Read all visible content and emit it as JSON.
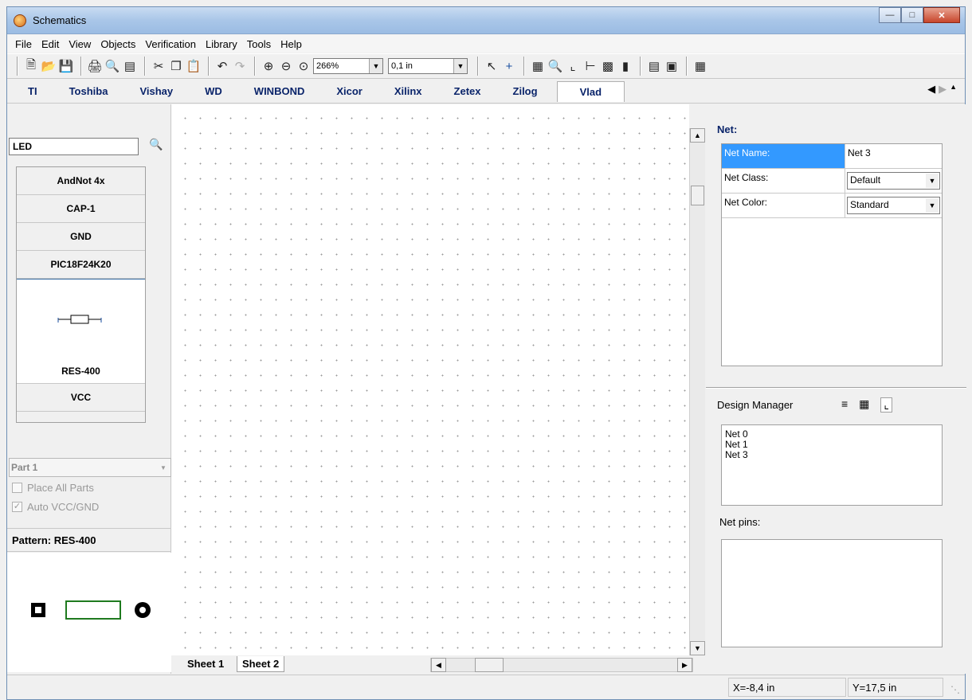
{
  "window": {
    "title": "Schematics"
  },
  "menu": [
    "File",
    "Edit",
    "View",
    "Objects",
    "Verification",
    "Library",
    "Tools",
    "Help"
  ],
  "toolbar": {
    "zoom": "266%",
    "grid": "0,1 in"
  },
  "libraries": [
    "TI",
    "Toshiba",
    "Vishay",
    "WD",
    "WINBOND",
    "Xicor",
    "Xilinx",
    "Zetex",
    "Zilog",
    "Vlad"
  ],
  "left": {
    "search_value": "LED",
    "parts": [
      "AndNot 4x",
      "CAP-1",
      "GND",
      "PIC18F24K20"
    ],
    "selected_part": "RES-400",
    "parts_after": [
      "VCC"
    ],
    "part_combo": "Part 1",
    "place_all": "Place All Parts",
    "auto_vcc": "Auto VCC/GND",
    "pattern_label": "Pattern: RES-400"
  },
  "sheets": [
    "Sheet 1",
    "Sheet 2"
  ],
  "right": {
    "net_header": "Net:",
    "props": [
      {
        "key": "Net Name:",
        "value": "Net 3"
      },
      {
        "key": "Net Class:",
        "value": "Default"
      },
      {
        "key": "Net Color:",
        "value": "Standard"
      }
    ],
    "dm_header": "Design Manager",
    "nets": [
      "Net 0",
      "Net 1",
      "Net 3"
    ],
    "net_pins_header": "Net pins:"
  },
  "status": {
    "x": "X=-8,4 in",
    "y": "Y=17,5 in"
  }
}
